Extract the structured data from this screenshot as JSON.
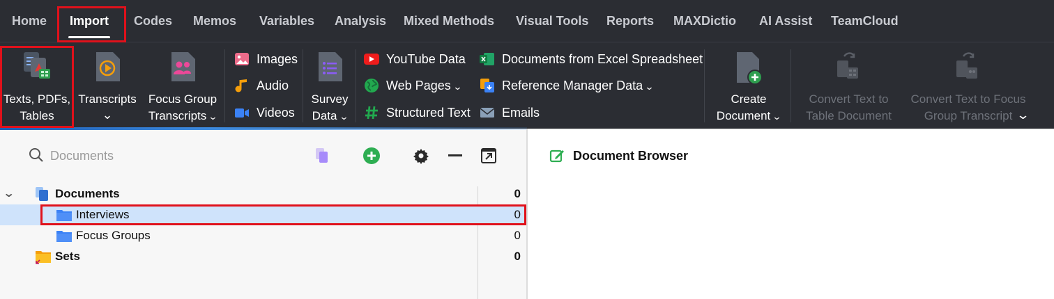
{
  "menu": {
    "items": [
      "Home",
      "Import",
      "Codes",
      "Memos",
      "Variables",
      "Analysis",
      "Mixed Methods",
      "Visual Tools",
      "Reports",
      "MAXDictio",
      "AI Assist",
      "TeamCloud"
    ],
    "active": "Import"
  },
  "ribbon": {
    "texts_pdfs_tables": {
      "line1": "Texts, PDFs,",
      "line2": "Tables"
    },
    "transcripts": {
      "line1": "Transcripts",
      "chevron": "⌄"
    },
    "focus_group": {
      "line1": "Focus Group",
      "line2": "Transcripts"
    },
    "media": {
      "images": "Images",
      "audio": "Audio",
      "videos": "Videos"
    },
    "survey": {
      "line1": "Survey",
      "line2": "Data"
    },
    "web": {
      "youtube": "YouTube Data",
      "web_pages": "Web Pages",
      "structured": "Structured Text"
    },
    "docs": {
      "excel": "Documents from Excel Spreadsheet",
      "refman": "Reference Manager Data",
      "emails": "Emails"
    },
    "create": {
      "line1": "Create",
      "line2": "Document"
    },
    "convert_table": {
      "line1": "Convert Text to",
      "line2": "Table Document"
    },
    "convert_focus": {
      "line1": "Convert Text to Focus",
      "line2": "Group Transcript"
    }
  },
  "documents_panel": {
    "search_placeholder": "Documents",
    "tree": [
      {
        "name": "Documents",
        "count": "0"
      },
      {
        "name": "Interviews",
        "count": "0"
      },
      {
        "name": "Focus Groups",
        "count": "0"
      },
      {
        "name": "Sets",
        "count": "0"
      }
    ]
  },
  "browser": {
    "title": "Document Browser"
  },
  "colors": {
    "accent": "#e0111b",
    "menubar": "#2b2d33",
    "selected_row": "#cfe3fb"
  }
}
